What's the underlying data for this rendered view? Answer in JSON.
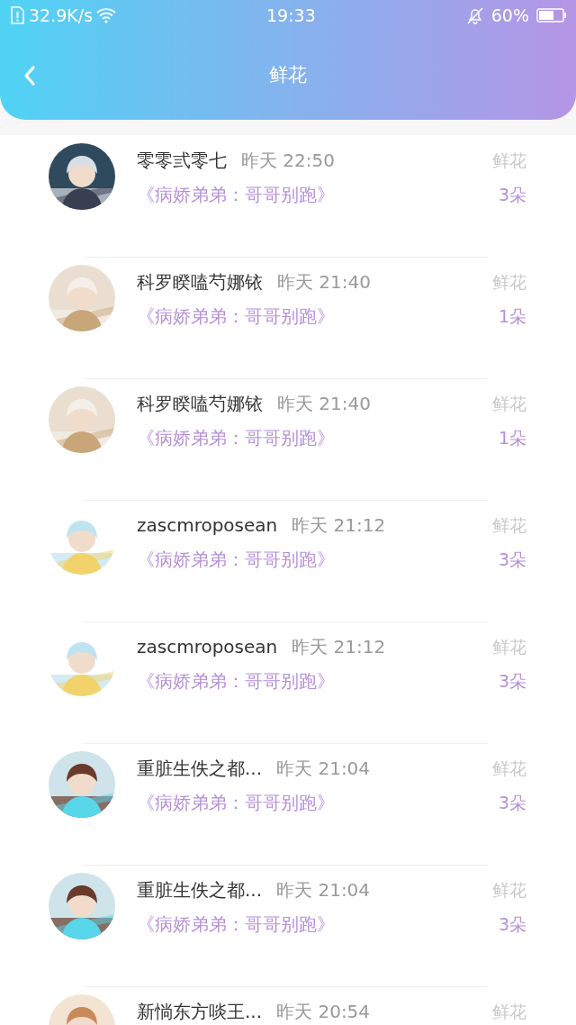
{
  "status_bar": {
    "speed": "32.9K/s",
    "time": "19:33",
    "battery": "60%"
  },
  "header": {
    "title": "鲜花"
  },
  "items": [
    {
      "name": "零零弎零七",
      "time": "昨天 22:50",
      "label": "鲜花",
      "book": "《病娇弟弟：哥哥别跑》",
      "count": "3朵"
    },
    {
      "name": "科罗睽嗑芍娜铱",
      "time": "昨天 21:40",
      "label": "鲜花",
      "book": "《病娇弟弟：哥哥别跑》",
      "count": "1朵"
    },
    {
      "name": "科罗睽嗑芍娜铱",
      "time": "昨天 21:40",
      "label": "鲜花",
      "book": "《病娇弟弟：哥哥别跑》",
      "count": "1朵"
    },
    {
      "name": "zascmroposean",
      "time": "昨天 21:12",
      "label": "鲜花",
      "book": "《病娇弟弟：哥哥别跑》",
      "count": "3朵"
    },
    {
      "name": "zascmroposean",
      "time": "昨天 21:12",
      "label": "鲜花",
      "book": "《病娇弟弟：哥哥别跑》",
      "count": "3朵"
    },
    {
      "name": "重脏生佚之都...",
      "time": "昨天 21:04",
      "label": "鲜花",
      "book": "《病娇弟弟：哥哥别跑》",
      "count": "3朵"
    },
    {
      "name": "重脏生佚之都...",
      "time": "昨天 21:04",
      "label": "鲜花",
      "book": "《病娇弟弟：哥哥别跑》",
      "count": "3朵"
    },
    {
      "name": "新惝东方啖王...",
      "time": "昨天 20:54",
      "label": "鲜花"
    }
  ]
}
